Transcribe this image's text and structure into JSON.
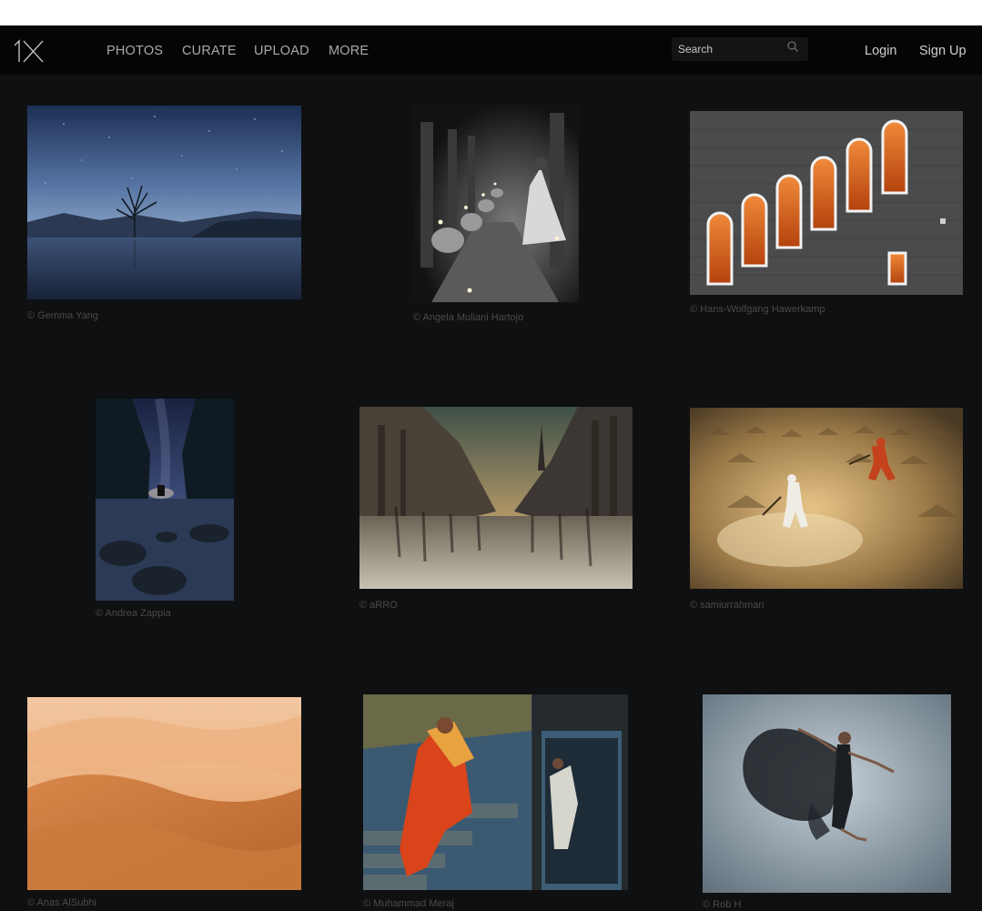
{
  "nav": {
    "logo": "1X",
    "links": [
      "PHOTOS",
      "CURATE",
      "UPLOAD",
      "MORE"
    ],
    "search_placeholder": "Search",
    "login": "Login",
    "signup": "Sign Up"
  },
  "photos": [
    {
      "credit": "© Gemma Yang",
      "subject": "starry lake with lone tree"
    },
    {
      "credit": "© Angela Muliani Hartojo",
      "subject": "woman with candles in corridor"
    },
    {
      "credit": "© Hans-Wolfgang Hawerkamp",
      "subject": "arched orange windows on brick wall"
    },
    {
      "credit": "© Andrea Zappia",
      "subject": "milky way over sea cove"
    },
    {
      "credit": "© aRRO",
      "subject": "motion-blurred city street"
    },
    {
      "credit": "© samiurrahman",
      "subject": "workers in golden sand field"
    },
    {
      "credit": "© Anas AlSubhi",
      "subject": "orange desert dunes"
    },
    {
      "credit": "© Muhammad Meraj",
      "subject": "woman in red sari on stairs"
    },
    {
      "credit": "© Rob H",
      "subject": "dancer leaping with black fabric"
    }
  ],
  "colors": {
    "background": "#0f1011",
    "navbar": "#050505",
    "credit_text": "#4a4a4a"
  }
}
